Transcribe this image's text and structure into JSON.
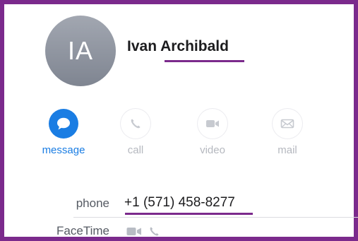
{
  "contact": {
    "initials": "IA",
    "name": "Ivan Archibald"
  },
  "actions": [
    {
      "label": "message",
      "icon": "message-bubble-icon",
      "enabled": true
    },
    {
      "label": "call",
      "icon": "phone-icon",
      "enabled": false
    },
    {
      "label": "video",
      "icon": "video-camera-icon",
      "enabled": false
    },
    {
      "label": "mail",
      "icon": "envelope-icon",
      "enabled": false
    }
  ],
  "fields": {
    "phone_label": "phone",
    "phone_value": "+1 (571) 458-8277",
    "facetime_label": "FaceTime",
    "facetime_icons": [
      "video-camera-icon",
      "phone-icon"
    ]
  },
  "colors": {
    "accent": "#1a7de3",
    "disabled": "#b5b8bf",
    "highlight_border": "#7b2a8c",
    "avatar": "#8f949e"
  }
}
